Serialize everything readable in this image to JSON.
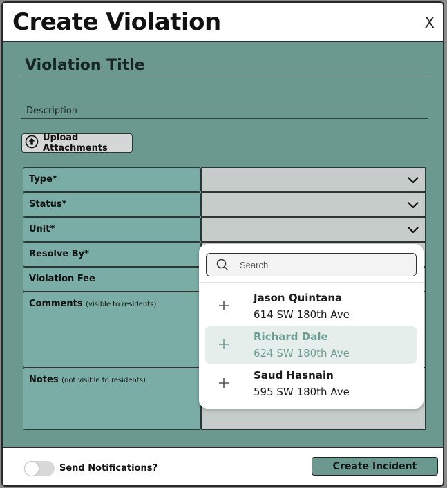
{
  "modal": {
    "title": "Create Violation",
    "close_label": "X"
  },
  "form": {
    "title_value": "Violation Title",
    "description_label": "Description",
    "upload_label": "Upload Attachments",
    "rows": [
      {
        "label": "Type*",
        "sub": ""
      },
      {
        "label": "Status*",
        "sub": ""
      },
      {
        "label": "Unit*",
        "sub": ""
      },
      {
        "label": "Resolve By*",
        "sub": ""
      },
      {
        "label": "Violation Fee",
        "sub": ""
      },
      {
        "label": "Comments",
        "sub": "(visible to residents)"
      },
      {
        "label": "Notes",
        "sub": "(not visible to residents)"
      }
    ]
  },
  "dropdown": {
    "search_placeholder": "Search",
    "options": [
      {
        "name": "Jason Quintana",
        "address": "614 SW 180th Ave",
        "highlighted": false
      },
      {
        "name": "Richard Dale",
        "address": "624 SW 180th Ave",
        "highlighted": true
      },
      {
        "name": "Saud Hasnain",
        "address": "595 SW 180th Ave",
        "highlighted": false
      }
    ]
  },
  "footer": {
    "notifications_label": "Send Notifications?",
    "notifications_on": false,
    "create_label": "Create Incident"
  },
  "colors": {
    "modal_bg": "#6b9990",
    "label_cell": "#79ada5",
    "select_cell": "#c6ccca",
    "highlight_text": "#6e9d93"
  },
  "icons": [
    "upload-icon",
    "chevron-down-icon",
    "search-icon",
    "plus-icon"
  ]
}
